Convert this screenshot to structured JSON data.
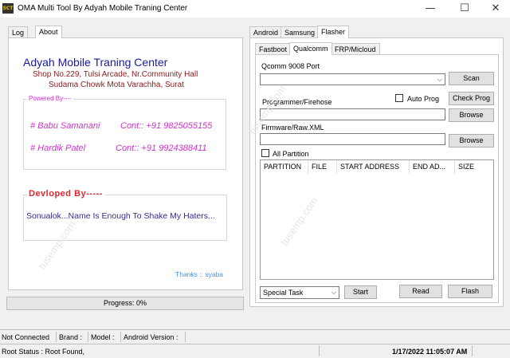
{
  "window": {
    "title": "OMA Multi Tool By Adyah Mobile Traning Center",
    "icon_text": "SCT",
    "controls": {
      "minimize": "—",
      "maximize": "☐",
      "close": "✕"
    }
  },
  "left_tabs": [
    "Log",
    "About"
  ],
  "about": {
    "company": "Adyah Mobile Traning Center",
    "address_line1": "Shop No.229, Tulsi Arcade, Nr.Community Hall",
    "address_line2": "Sudama Chowk Mota Varachha, Surat",
    "powered_by_legend": "Powered By----",
    "contact1_name": "# Babu Samanani",
    "contact1_phone": "Cont:: +91 9825055155",
    "contact2_name": "# Hardik Patel",
    "contact2_phone": "Cont:: +91 9924388411",
    "developed_legend": "Devloped By-----",
    "developer_text": "Sonualok...Name Is Enough To Shake My Haters...",
    "thanks_text": "Thanks :: syaba"
  },
  "progress": {
    "label": "Progress: 0%",
    "value": 0
  },
  "right_tabs": [
    "Android",
    "Samsung",
    "Flasher"
  ],
  "flasher_tabs": [
    "Fastboot",
    "Qualcomm",
    "FRP/Micloud"
  ],
  "qualcomm": {
    "port_label": "Qcomm 9008 Port",
    "port_value": "",
    "scan_button": "Scan",
    "programmer_label": "Programmer/Firehose",
    "programmer_value": "",
    "auto_prog_label": "Auto Prog",
    "check_prog_button": "Check Prog",
    "browse_button_1": "Browse",
    "firmware_label": "Firmware/Raw.XML",
    "firmware_value": "",
    "browse_button_2": "Browse",
    "all_partition_label": "All Partition",
    "table_columns": [
      "PARTITION",
      "FILE",
      "START ADDRESS",
      "END AD...",
      "SIZE"
    ],
    "special_task_value": "Special Task",
    "start_button": "Start",
    "read_button": "Read",
    "flash_button": "Flash"
  },
  "status_bar": {
    "connection": "Not Connected",
    "brand": "Brand :",
    "model": "Model :",
    "android_version": "Android Version :",
    "root_status": "Root Status : Root Found,",
    "datetime": "1/17/2022 11:05:07 AM"
  },
  "watermark_text": "tusemp.com",
  "colors": {
    "company": "#1a1aa0",
    "address": "#8b1a1a",
    "contact": "#cc33cc",
    "developed": "#e0242a",
    "developer_text": "#3a2a8a",
    "thanks": "#4a90e2"
  }
}
